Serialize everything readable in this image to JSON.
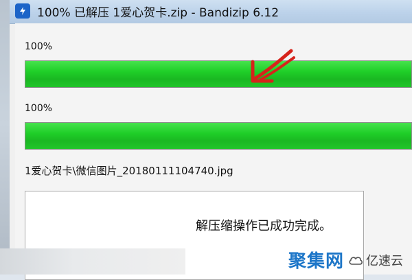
{
  "window": {
    "title": "100% 已解压 1爱心贺卡.zip - Bandizip 6.12"
  },
  "progress": {
    "file": {
      "label": "100%",
      "fraction": 1.0
    },
    "total": {
      "label": "100%",
      "fraction": 1.0
    }
  },
  "current_file": "1爱心贺卡\\微信图片_20180111104740.jpg",
  "log": {
    "message": "解压缩操作已成功完成。"
  },
  "watermark": {
    "main": "聚集网",
    "sub": "亿速云"
  },
  "colors": {
    "progress_green": "#1fcf28",
    "arrow_red": "#d6231b",
    "watermark_blue": "#1d76c8"
  }
}
